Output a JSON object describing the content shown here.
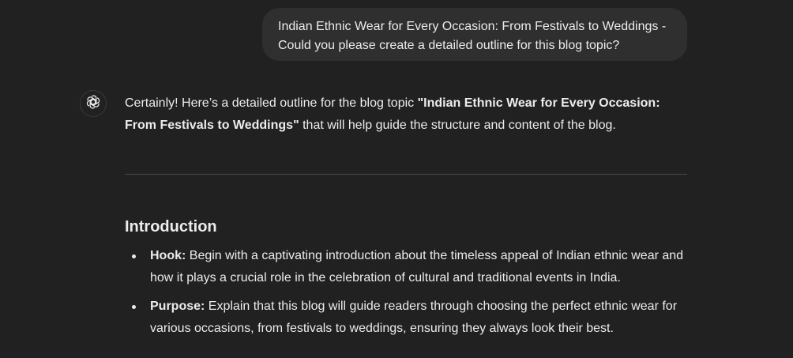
{
  "user_message": {
    "text": "Indian Ethnic Wear for Every Occasion: From Festivals to Weddings - Could you please create a detailed outline for this blog topic?"
  },
  "assistant": {
    "avatar_icon": "openai-logo-icon",
    "intro_prefix": "Certainly! Here’s a detailed outline for the blog topic ",
    "intro_bold": "\"Indian Ethnic Wear for Every Occasion: From Festivals to Weddings\"",
    "intro_suffix": " that will help guide the structure and content of the blog.",
    "section_heading": "Introduction",
    "bullets": [
      {
        "label": "Hook:",
        "text": " Begin with a captivating introduction about the timeless appeal of Indian ethnic wear and how it plays a crucial role in the celebration of cultural and traditional events in India."
      },
      {
        "label": "Purpose:",
        "text": " Explain that this blog will guide readers through choosing the perfect ethnic wear for various occasions, from festivals to weddings, ensuring they always look their best."
      }
    ]
  },
  "colors": {
    "background": "#212121",
    "user_bubble": "#2f2f2f",
    "text": "#ececec",
    "divider": "#4a4a4a"
  }
}
